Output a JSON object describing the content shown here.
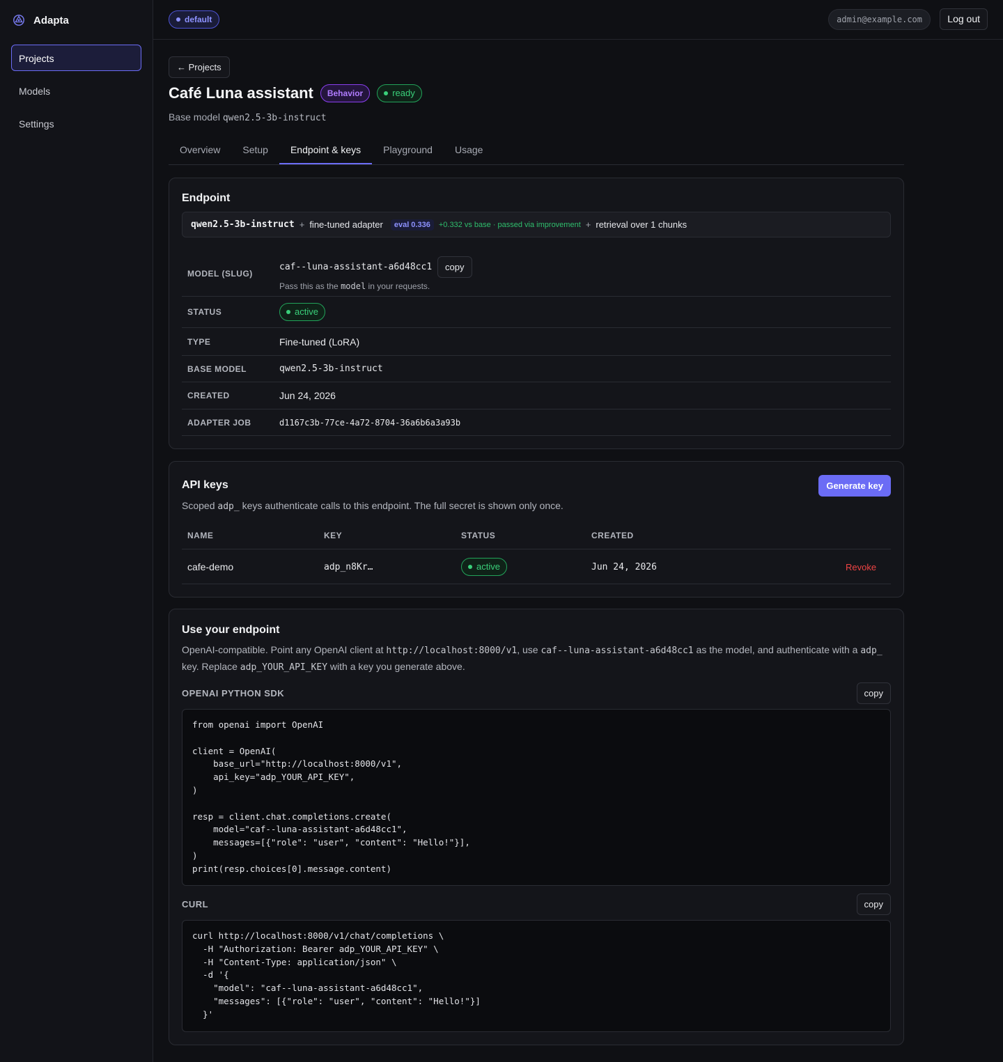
{
  "app": {
    "name": "Adapta",
    "logo_icon": "atom-logo-icon"
  },
  "sidebar": {
    "items": [
      {
        "label": "Projects",
        "active": true
      },
      {
        "label": "Models",
        "active": false
      },
      {
        "label": "Settings",
        "active": false
      }
    ]
  },
  "topbar": {
    "org_badge": "default",
    "user_email": "admin@example.com",
    "logout_label": "Log out"
  },
  "header": {
    "back_label": "← Projects",
    "title": "Café Luna assistant",
    "type_badge": "Behavior",
    "status_badge": "ready",
    "base_model_prefix": "Base model",
    "base_model": "qwen2.5-3b-instruct"
  },
  "tabs": [
    {
      "label": "Overview",
      "active": false
    },
    {
      "label": "Setup",
      "active": false
    },
    {
      "label": "Endpoint & keys",
      "active": true
    },
    {
      "label": "Playground",
      "active": false
    },
    {
      "label": "Usage",
      "active": false
    }
  ],
  "endpoint": {
    "title": "Endpoint",
    "summary": {
      "model": "qwen2.5-3b-instruct",
      "plus": "+",
      "adapter_text": "fine-tuned adapter",
      "eval": "eval 0.336",
      "delta": "+0.332 vs base · passed via improvement",
      "retrieval_text": "retrieval over 1 chunks"
    },
    "fields": {
      "model_slug_label": "MODEL (SLUG)",
      "model_slug": "caf--luna-assistant-a6d48cc1",
      "copy_label": "copy",
      "hint_prefix": "Pass this as the",
      "hint_code": "model",
      "hint_suffix": "in your requests.",
      "status_label": "STATUS",
      "status": "active",
      "type_label": "TYPE",
      "type": "Fine-tuned (LoRA)",
      "base_model_label": "BASE MODEL",
      "base_model": "qwen2.5-3b-instruct",
      "created_label": "CREATED",
      "created": "Jun 24, 2026",
      "adapter_job_label": "ADAPTER JOB",
      "adapter_job": "d1167c3b-77ce-4a72-8704-36a6b6a3a93b"
    }
  },
  "api_keys": {
    "title": "API keys",
    "generate_label": "Generate key",
    "desc_prefix": "Scoped",
    "desc_code": "adp_",
    "desc_suffix": "keys authenticate calls to this endpoint. The full secret is shown only once.",
    "columns": [
      "NAME",
      "KEY",
      "STATUS",
      "CREATED"
    ],
    "rows": [
      {
        "name": "cafe-demo",
        "key": "adp_n8Kr…",
        "status": "active",
        "created": "Jun 24, 2026",
        "action": "Revoke"
      }
    ]
  },
  "usage": {
    "title": "Use your endpoint",
    "desc_1": "OpenAI-compatible. Point any OpenAI client at",
    "desc_url": "http://localhost:8000/v1",
    "desc_2": ", use",
    "desc_model": "caf--luna-assistant-a6d48cc1",
    "desc_3": "as the model, and authenticate with a",
    "desc_prefix_code": "adp_",
    "desc_4": "key. Replace",
    "desc_placeholder": "adp_YOUR_API_KEY",
    "desc_5": "with a key you generate above.",
    "python_label": "OPENAI PYTHON SDK",
    "python_code": "from openai import OpenAI\n\nclient = OpenAI(\n    base_url=\"http://localhost:8000/v1\",\n    api_key=\"adp_YOUR_API_KEY\",\n)\n\nresp = client.chat.completions.create(\n    model=\"caf--luna-assistant-a6d48cc1\",\n    messages=[{\"role\": \"user\", \"content\": \"Hello!\"}],\n)\nprint(resp.choices[0].message.content)",
    "curl_label": "CURL",
    "curl_code": "curl http://localhost:8000/v1/chat/completions \\\n  -H \"Authorization: Bearer adp_YOUR_API_KEY\" \\\n  -H \"Content-Type: application/json\" \\\n  -d '{\n    \"model\": \"caf--luna-assistant-a6d48cc1\",\n    \"messages\": [{\"role\": \"user\", \"content\": \"Hello!\"}]\n  }'",
    "copy_label": "copy"
  },
  "colors": {
    "accent": "#6b6cf5",
    "success": "#3ad07a",
    "danger": "#ef4444",
    "behavior": "#b07cff"
  }
}
